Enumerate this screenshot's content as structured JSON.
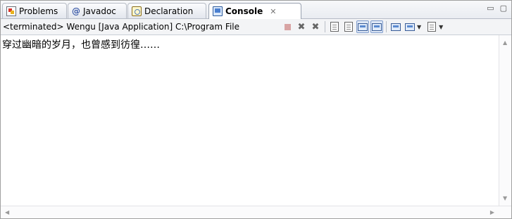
{
  "tabs": [
    {
      "label": "Problems",
      "icon": "problems-icon"
    },
    {
      "label": "Javadoc",
      "icon": "at-sign-icon"
    },
    {
      "label": "Declaration",
      "icon": "declaration-icon"
    },
    {
      "label": "Console",
      "icon": "console-icon",
      "active": true,
      "close": "✕"
    }
  ],
  "view_controls": {
    "minimize": "▭",
    "maximize": "▢"
  },
  "toolbar": {
    "process_label": "<terminated> Wengu [Java Application] C:\\Program File",
    "buttons": [
      "terminate-icon",
      "remove-launch-icon",
      "remove-all-terminated-icon",
      "clear-console-icon",
      "scroll-lock-icon",
      "word-wrap-icon",
      "show-console-on-output-icon",
      "pin-console-icon",
      "display-selected-console-icon",
      "open-console-icon"
    ]
  },
  "console": {
    "output": "穿过幽暗的岁月，也曾感到彷徨……"
  },
  "scrollbars": {
    "up": "▲",
    "down": "▼",
    "left": "◀",
    "right": "▶"
  }
}
